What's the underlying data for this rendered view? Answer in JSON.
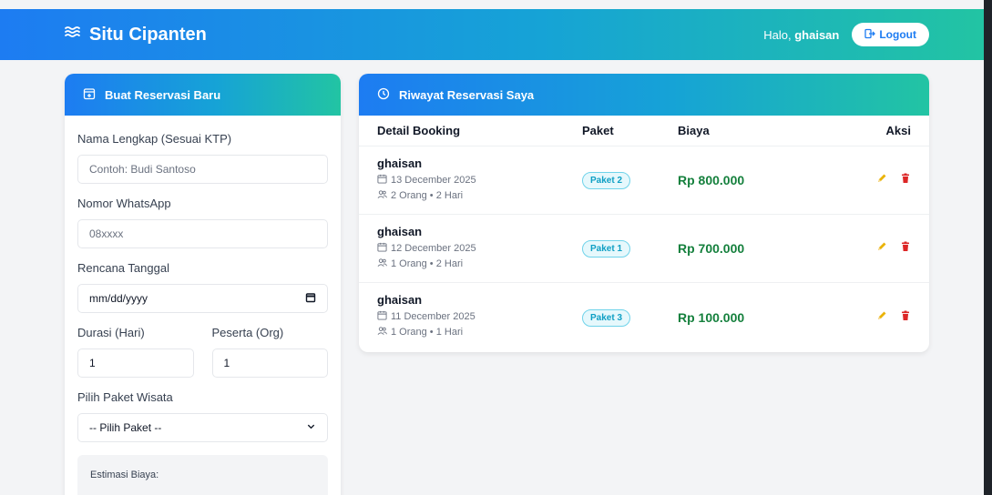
{
  "navbar": {
    "brand": "Situ Cipanten",
    "greeting": "Halo,",
    "username": "ghaisan",
    "logout_label": "Logout"
  },
  "form": {
    "title": "Buat Reservasi Baru",
    "name_label": "Nama Lengkap (Sesuai KTP)",
    "name_placeholder": "Contoh: Budi Santoso",
    "phone_label": "Nomor WhatsApp",
    "phone_placeholder": "08xxxx",
    "date_label": "Rencana Tanggal",
    "date_placeholder": "mm/dd/yyyy",
    "duration_label": "Durasi (Hari)",
    "duration_value": "1",
    "participants_label": "Peserta (Org)",
    "participants_value": "1",
    "package_label": "Pilih Paket Wisata",
    "package_selected": "-- Pilih Paket --",
    "estimate_label": "Estimasi Biaya:"
  },
  "history": {
    "title": "Riwayat Reservasi Saya",
    "columns": [
      "Detail Booking",
      "Paket",
      "Biaya",
      "Aksi"
    ],
    "rows": [
      {
        "name": "ghaisan",
        "date": "13 December 2025",
        "info": "2 Orang • 2 Hari",
        "package": "Paket 2",
        "price": "Rp 800.000"
      },
      {
        "name": "ghaisan",
        "date": "12 December 2025",
        "info": "1 Orang • 2 Hari",
        "package": "Paket 1",
        "price": "Rp 700.000"
      },
      {
        "name": "ghaisan",
        "date": "11 December 2025",
        "info": "1 Orang • 1 Hari",
        "package": "Paket 3",
        "price": "Rp 100.000"
      }
    ]
  },
  "colors": {
    "gradient_start": "#1d7cf2",
    "gradient_end": "#22c4a3",
    "price_green": "#15803d",
    "edit_yellow": "#eab308",
    "delete_red": "#dc2626"
  },
  "icons": {
    "brand": "waves-icon",
    "logout": "logout-icon",
    "form_header": "calendar-plus-icon",
    "history_header": "clock-icon",
    "date": "calendar-icon",
    "people": "users-icon",
    "edit": "pencil-icon",
    "delete": "trash-icon",
    "date_picker": "calendar-icon",
    "select": "chevron-down-icon"
  }
}
